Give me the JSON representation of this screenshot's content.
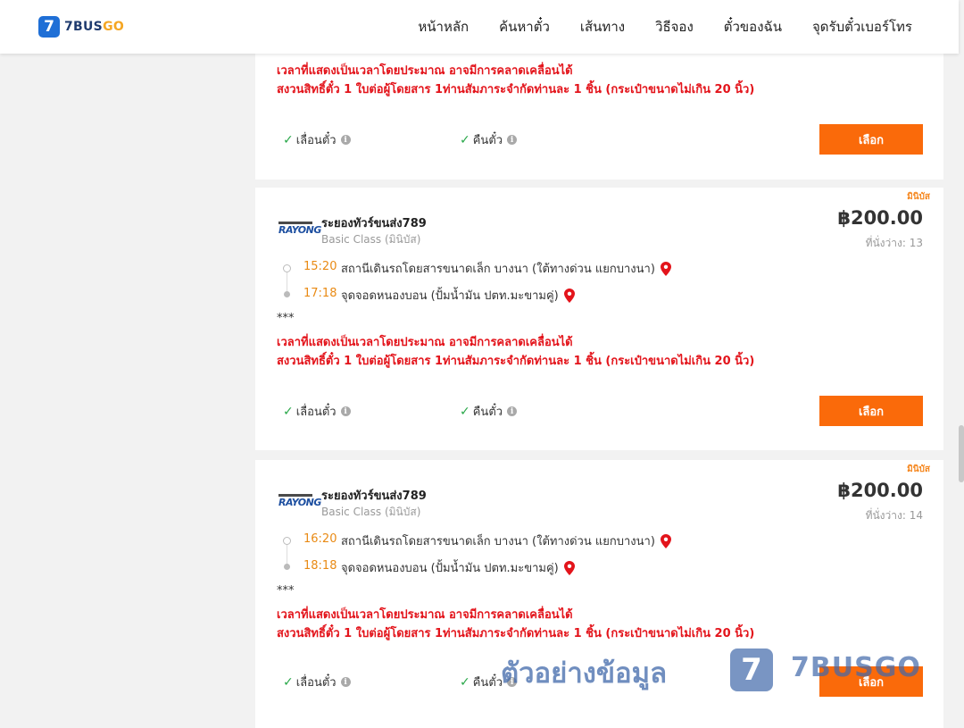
{
  "header": {
    "logo_mark": "7",
    "logo_text_a": "7BUS",
    "logo_text_b": "GO",
    "nav": [
      "หน้าหลัก",
      "ค้นหาตั๋ว",
      "เส้นทาง",
      "วิธีจอง",
      "ตั๋วของฉัน",
      "จุดรับตั๋วเบอร์โทร"
    ]
  },
  "notice": {
    "stars": "***",
    "line1": "เวลาที่แสดงเป็นเวลาโดยประมาณ อาจมีการคลาดเคลื่อนได้",
    "line2": "สงวนสิทธิ์ตั๋ว 1 ใบต่อผู้โดยสาร 1ท่านสัมภาระจำกัดท่านละ 1 ชิ้น (กระเป๋าขนาดไม่เกิน 20 นิ้ว)"
  },
  "features": {
    "reschedule": "เลื่อนตั๋ว",
    "refund": "คืนตั๋ว",
    "info_icon": "i"
  },
  "select_label": "เลือก",
  "trips": [
    {
      "tag": "มินิบัส",
      "operator_logo": "RAYONG",
      "operator": "ระยองทัวร์ขนส่ง789",
      "class": "Basic Class (มินิบัส)",
      "price": "฿200.00",
      "seats": "ที่นั่งว่าง: 13",
      "depart_time": "15:20",
      "depart_stop": "สถานีเดินรถโดยสารขนาดเล็ก บางนา (ใต้ทางด่วน แยกบางนา)",
      "arrive_time": "17:18",
      "arrive_stop": "จุดจอดหนองบอน (ปั้มน้ำมัน ปตท.มะขามคู่)"
    },
    {
      "tag": "มินิบัส",
      "operator_logo": "RAYONG",
      "operator": "ระยองทัวร์ขนส่ง789",
      "class": "Basic Class (มินิบัส)",
      "price": "฿200.00",
      "seats": "ที่นั่งว่าง: 14",
      "depart_time": "16:20",
      "depart_stop": "สถานีเดินรถโดยสารขนาดเล็ก บางนา (ใต้ทางด่วน แยกบางนา)",
      "arrive_time": "18:18",
      "arrive_stop": "จุดจอดหนองบอน (ปั้มน้ำมัน ปตท.มะขามคู่)"
    }
  ],
  "watermark": {
    "text": "ตัวอย่างข้อมูล",
    "mark": "7",
    "brand": "7BUSGO"
  },
  "colors": {
    "accent": "#fa6a0a",
    "warning": "#e3141b",
    "time": "#e98a14",
    "brand_blue": "#1f6fd6"
  }
}
